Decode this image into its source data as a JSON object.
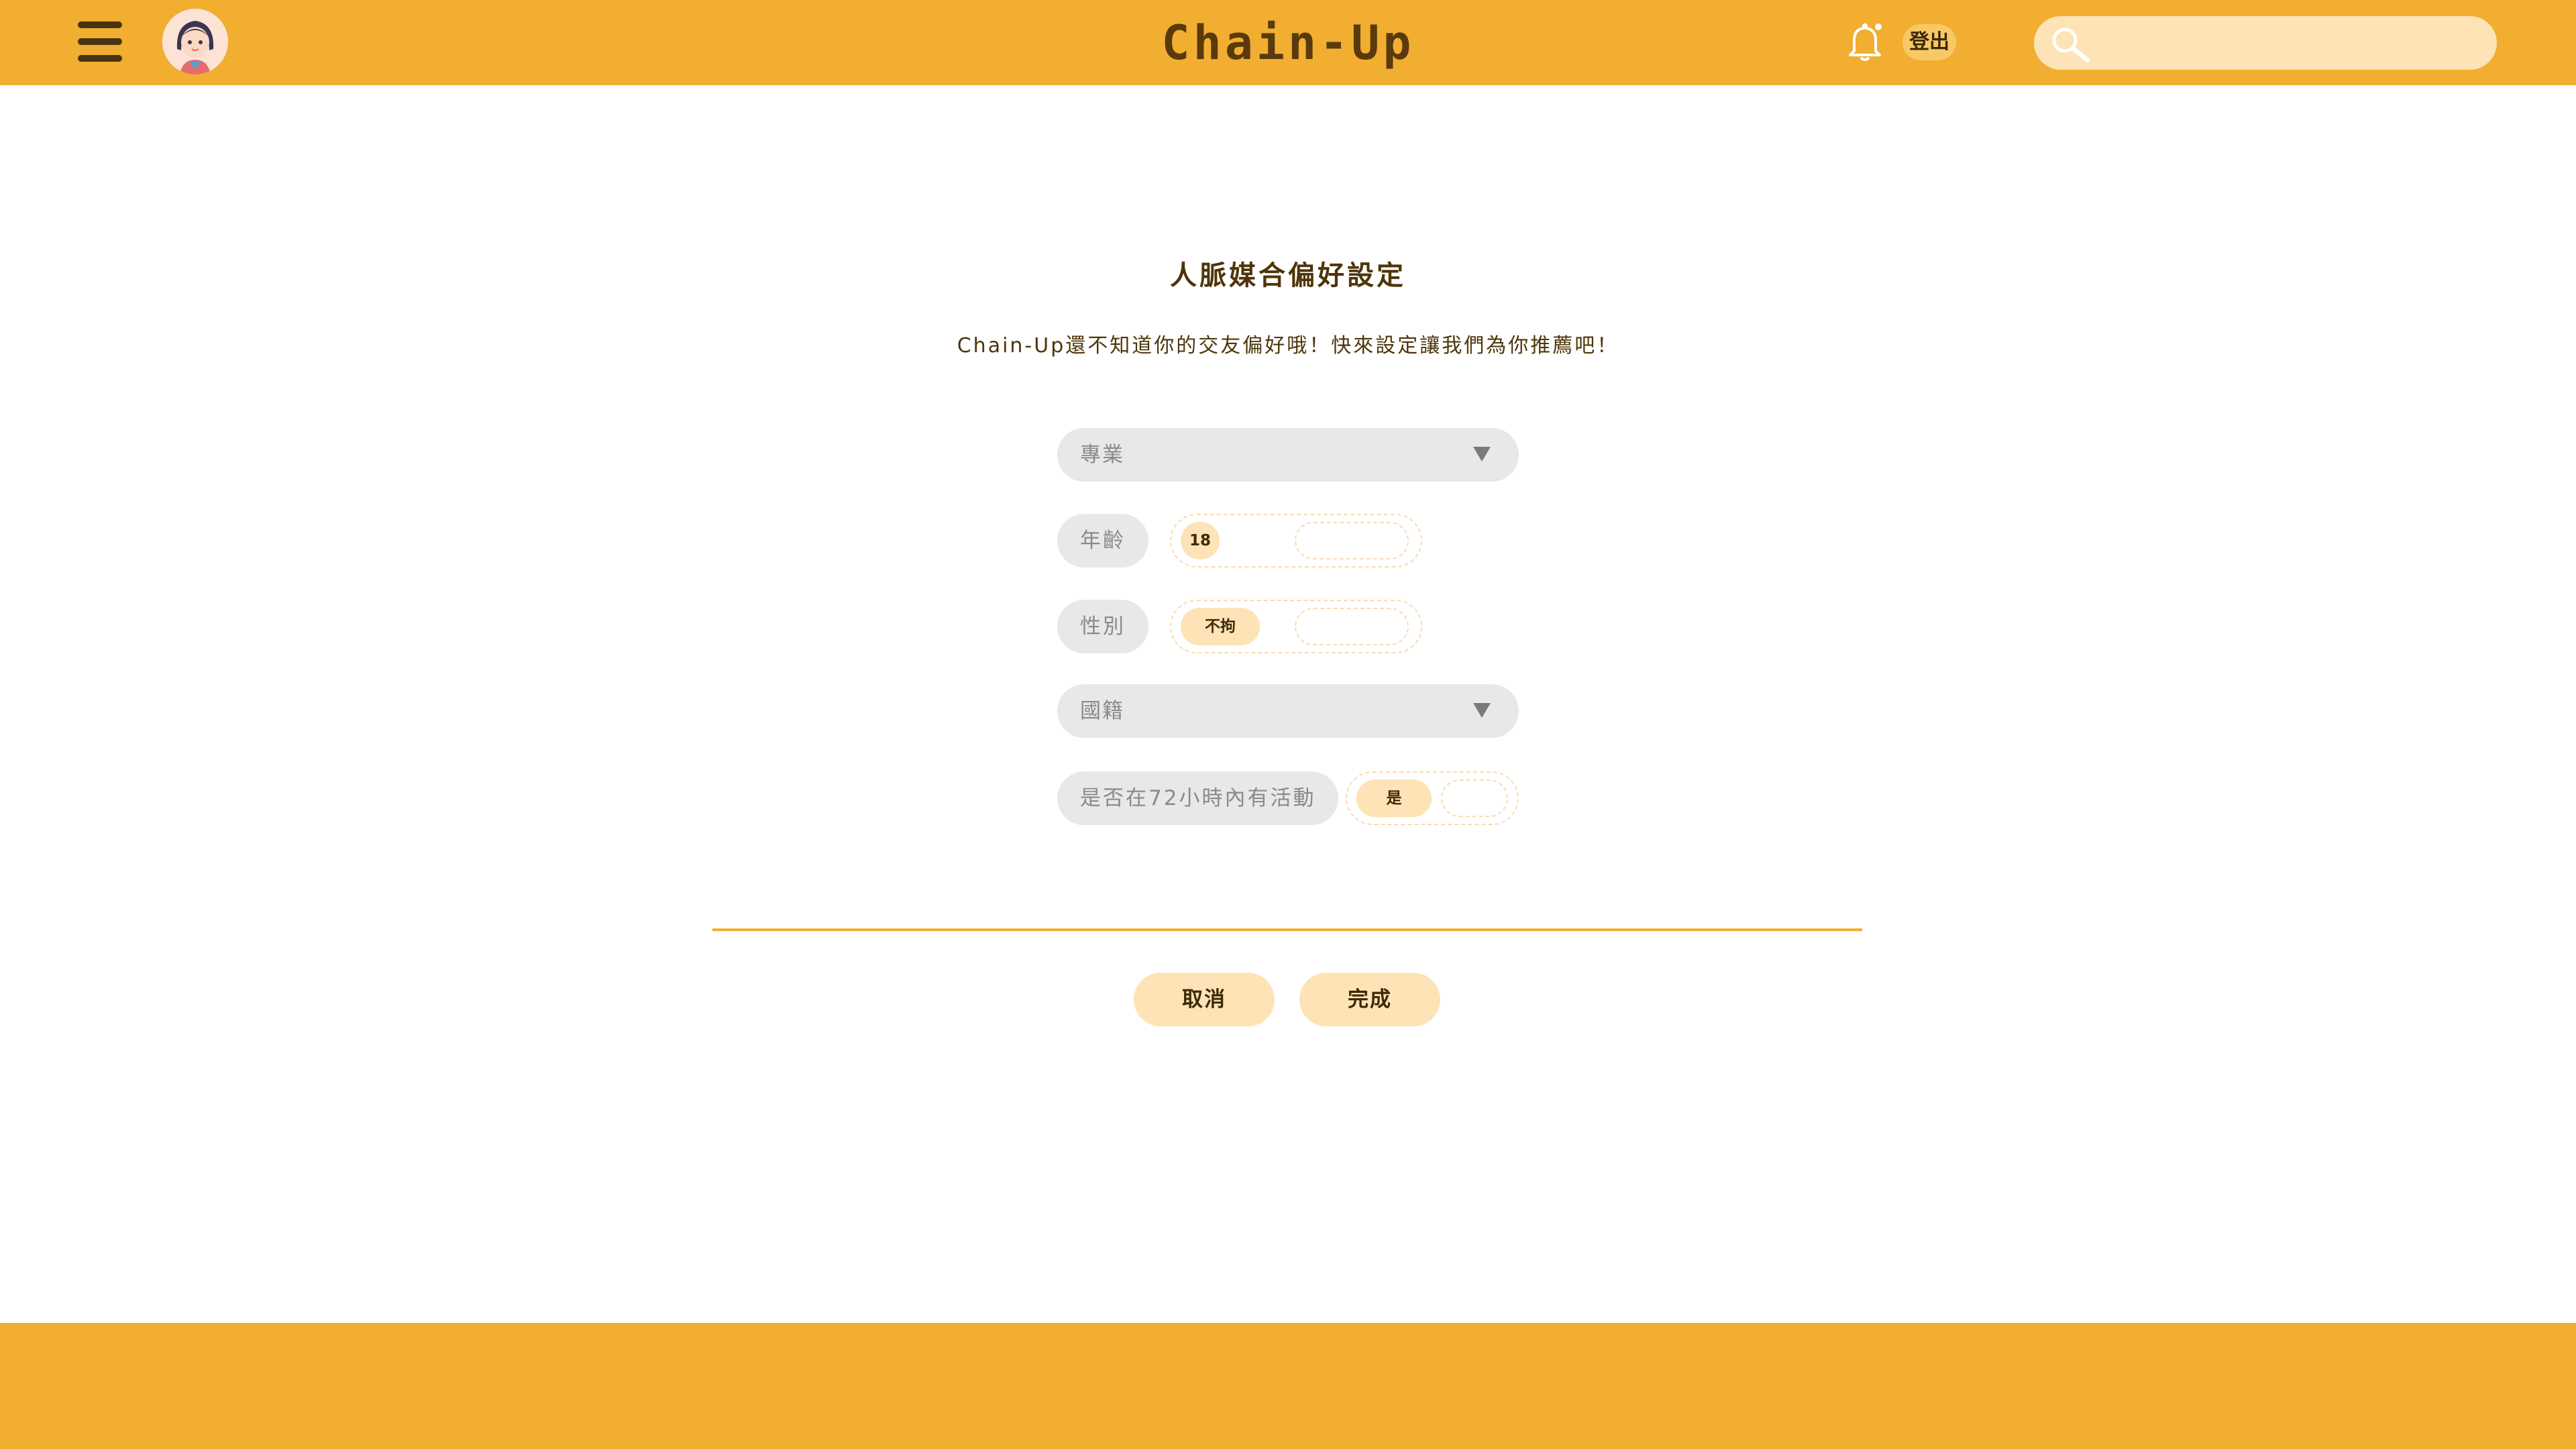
{
  "header": {
    "brand": "Chain-Up",
    "logout_label": "登出",
    "search_placeholder": ""
  },
  "main": {
    "title": "人脈媒合偏好設定",
    "subtitle": "Chain-Up還不知道你的交友偏好哦！快來設定讓我們為你推薦吧！",
    "profession_placeholder": "專業",
    "age": {
      "label": "年齡",
      "selected": "18"
    },
    "gender": {
      "label": "性別",
      "selected": "不拘"
    },
    "nationality_placeholder": "國籍",
    "active72": {
      "label": "是否在72小時內有活動",
      "selected": "是"
    },
    "cancel_label": "取消",
    "done_label": "完成"
  },
  "colors": {
    "accent": "#f1ae30",
    "chip": "#fde3b6",
    "field": "#e8e8e8",
    "text_dark": "#4e3509"
  },
  "icons": [
    "hamburger-menu-icon",
    "avatar",
    "bell-icon",
    "search-icon"
  ]
}
